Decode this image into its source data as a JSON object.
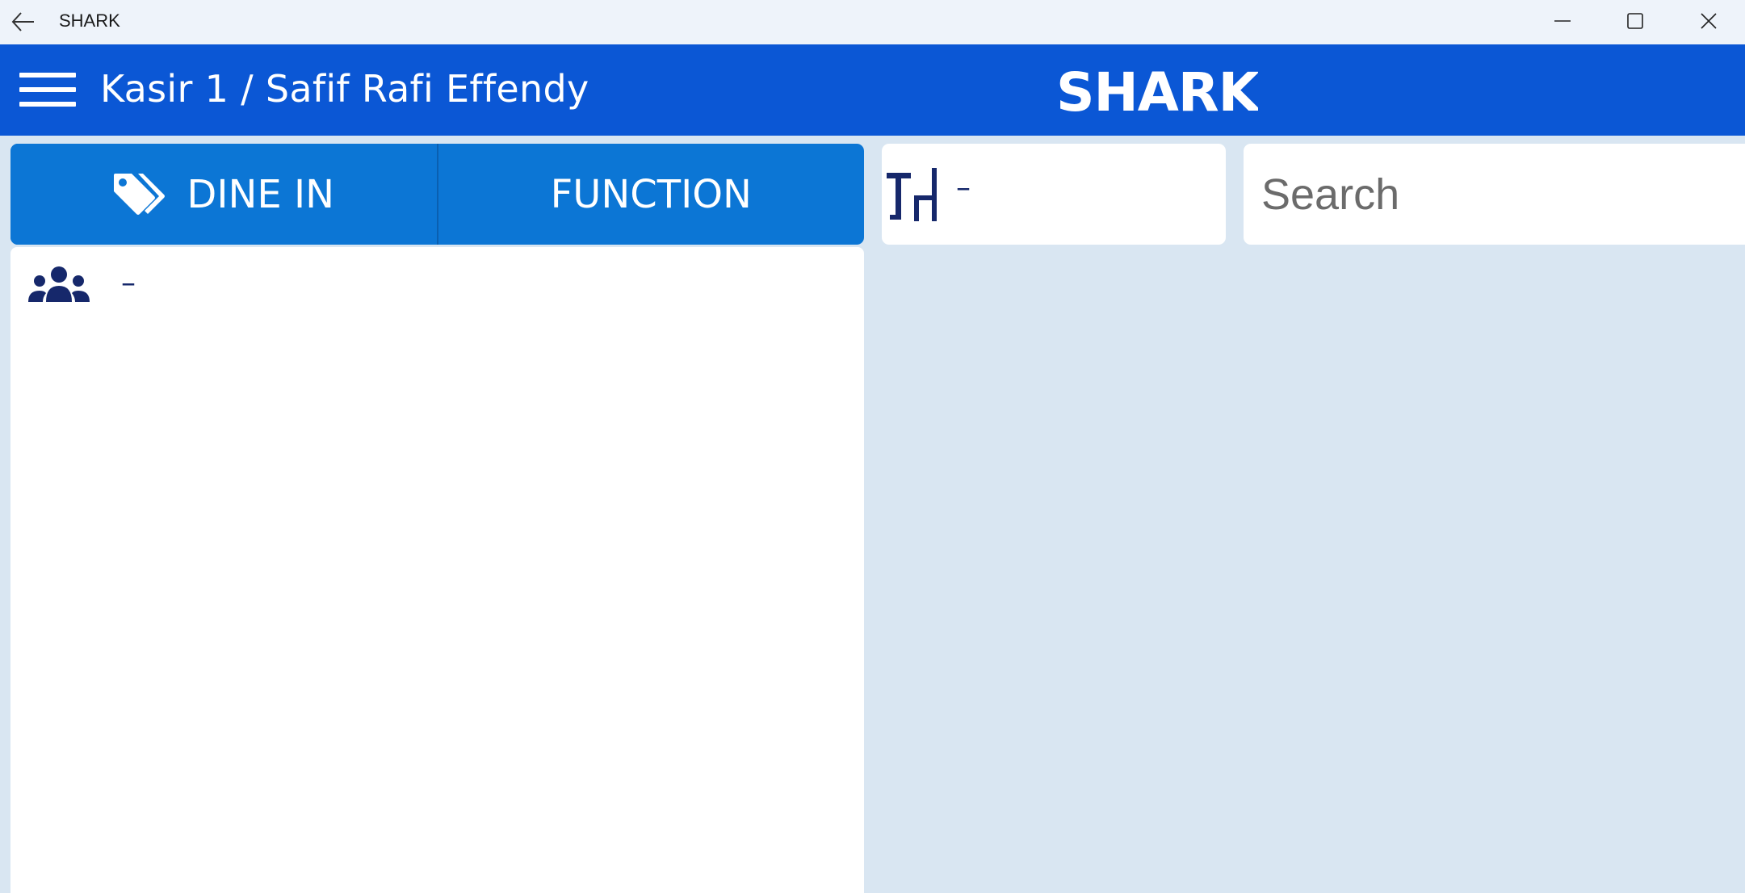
{
  "window": {
    "title": "SHARK",
    "back_icon": "arrow-left-icon",
    "controls": [
      "minimize-icon",
      "maximize-icon",
      "close-icon"
    ]
  },
  "header": {
    "menu_icon": "hamburger-icon",
    "cashier_label": "Kasir 1 / Safif Rafi Effendy",
    "logo_text": "SHARK",
    "background_color": "#0b57d5"
  },
  "order_type": {
    "dine_in_label": "DINE IN",
    "dine_in_icon": "tags-icon",
    "function_label": "FUNCTION",
    "color": "#0c76d5"
  },
  "customer": {
    "icon": "users-icon",
    "value": "–"
  },
  "table": {
    "icon": "table-chair-icon",
    "value": "–"
  },
  "search": {
    "placeholder": "Search",
    "value": ""
  }
}
